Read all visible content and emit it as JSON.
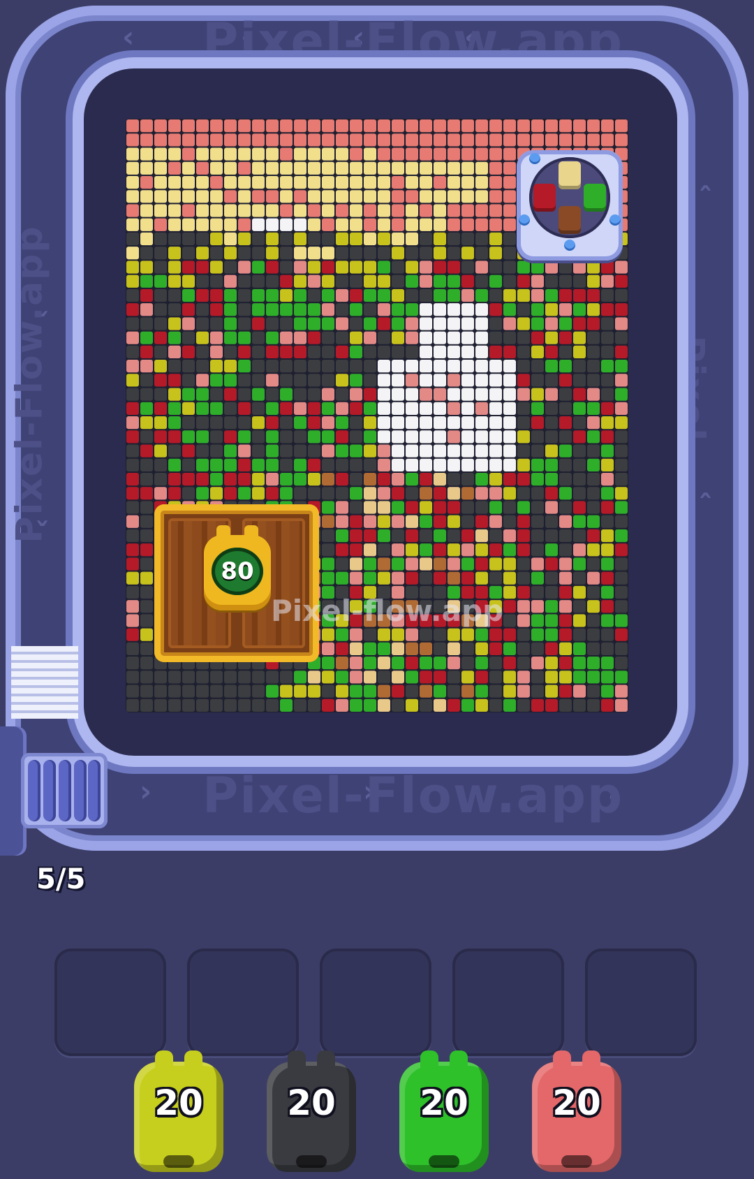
{
  "watermark": {
    "center": "Pixel-flow.app",
    "top": "Pixel-Flow.app",
    "bottom": "Pixel-Flow.app",
    "left": "Pixel-Flow.app",
    "right": "Pixel-Flow.app"
  },
  "lock": {
    "count": "80"
  },
  "conveyor": {
    "counter": "5/5"
  },
  "slots": [
    {},
    {},
    {},
    {},
    {}
  ],
  "pigs": [
    {
      "label": "20",
      "color": "#c7cf1e"
    },
    {
      "label": "20",
      "color": "#3a3b40"
    },
    {
      "label": "20",
      "color": "#2ec12a"
    },
    {
      "label": "20",
      "color": "#e4686a"
    }
  ],
  "palette": {
    "salmon": "#e77a72",
    "cream": "#f2df8c",
    "white": "#f4f4f6",
    "olive": "#c7c21c",
    "green": "#2fae2a",
    "red": "#b51a28",
    "dark": "#3b3d40",
    "pink": "#e48a86",
    "brown": "#b06a34",
    "tan": "#e9c98a"
  },
  "spinner": {
    "cells": [
      "#e9d58c",
      "#b51a28",
      "#2fae2a",
      "#8a4a26"
    ]
  }
}
